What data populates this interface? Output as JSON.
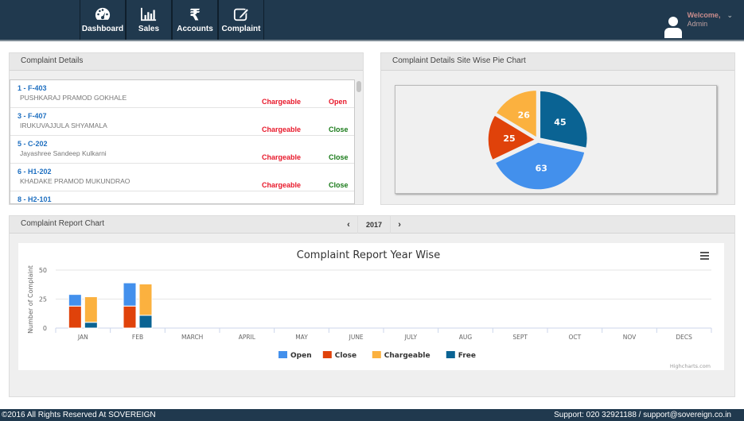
{
  "nav": {
    "items": [
      {
        "label": "Dashboard",
        "icon": "dashboard-gauge-icon"
      },
      {
        "label": "Sales",
        "icon": "bar-chart-icon"
      },
      {
        "label": "Accounts",
        "icon": "rupee-icon"
      },
      {
        "label": "Complaint",
        "icon": "edit-icon"
      }
    ]
  },
  "user": {
    "welcome": "Welcome,",
    "name": "Admin",
    "icon": "user-avatar-icon",
    "caret": "⌄"
  },
  "complaint_details": {
    "title": "Complaint Details",
    "rows": [
      {
        "id": "1 - F-403",
        "name": "PUSHKARAJ PRAMOD GOKHALE",
        "charge": "Chargeable",
        "status": "Open"
      },
      {
        "id": "3 - F-407",
        "name": "IRUKUVAJJULA SHYAMALA",
        "charge": "Chargeable",
        "status": "Close"
      },
      {
        "id": "5 - C-202",
        "name": "Jayashree Sandeep Kulkarni",
        "charge": "Chargeable",
        "status": "Close"
      },
      {
        "id": "6 - H1-202",
        "name": "KHADAKE PRAMOD MUKUNDRAO",
        "charge": "Chargeable",
        "status": "Close"
      },
      {
        "id": "8 - H2-101",
        "name": "",
        "charge": "",
        "status": ""
      }
    ]
  },
  "pie_panel": {
    "title": "Complaint Details Site Wise Pie Chart"
  },
  "report_panel": {
    "title": "Complaint Report Chart",
    "year": "2017",
    "prev": "‹",
    "next": "›",
    "menu_icon": "hamburger-menu-icon",
    "credit": "Highcharts.com"
  },
  "colors": {
    "open": "#4390ec",
    "close": "#e0420a",
    "chargeable": "#fbb13f",
    "free": "#0a6393"
  },
  "chart_data": [
    {
      "type": "pie",
      "title": "Complaint Details Site Wise Pie Chart",
      "slices": [
        {
          "label": "Free",
          "value": 45,
          "color": "#0a6393"
        },
        {
          "label": "Open",
          "value": 63,
          "color": "#4390ec"
        },
        {
          "label": "Close",
          "value": 25,
          "color": "#e0420a"
        },
        {
          "label": "Chargeable",
          "value": 26,
          "color": "#fbb13f"
        }
      ]
    },
    {
      "type": "bar",
      "title": "Complaint Report Year Wise",
      "xlabel": "",
      "ylabel": "Number of Complaint",
      "ylim": [
        0,
        50
      ],
      "yticks": [
        0,
        25,
        50
      ],
      "grid": true,
      "legend": "bottom-center",
      "categories": [
        "JAN",
        "FEB",
        "MARCH",
        "APRIL",
        "MAY",
        "JUNE",
        "JULY",
        "AUG",
        "SEPT",
        "OCT",
        "NOV",
        "DECS"
      ],
      "series": [
        {
          "name": "Open",
          "stack": "status",
          "color": "#4390ec",
          "values": [
            10,
            20,
            0,
            0,
            0,
            0,
            0,
            0,
            0,
            0,
            0,
            0
          ]
        },
        {
          "name": "Close",
          "stack": "status",
          "color": "#e0420a",
          "values": [
            19,
            19,
            0,
            0,
            0,
            0,
            0,
            0,
            0,
            0,
            0,
            0
          ]
        },
        {
          "name": "Chargeable",
          "stack": "type",
          "color": "#fbb13f",
          "values": [
            22,
            27,
            0,
            0,
            0,
            0,
            0,
            0,
            0,
            0,
            0,
            0
          ]
        },
        {
          "name": "Free",
          "stack": "type",
          "color": "#0a6393",
          "values": [
            5,
            11,
            0,
            0,
            0,
            0,
            0,
            0,
            0,
            0,
            0,
            0
          ]
        }
      ]
    }
  ],
  "footer": {
    "copyright": "©2016 All Rights Reserved At SOVEREIGN",
    "support": "Support: 020 32921188 / support@sovereign.co.in"
  }
}
